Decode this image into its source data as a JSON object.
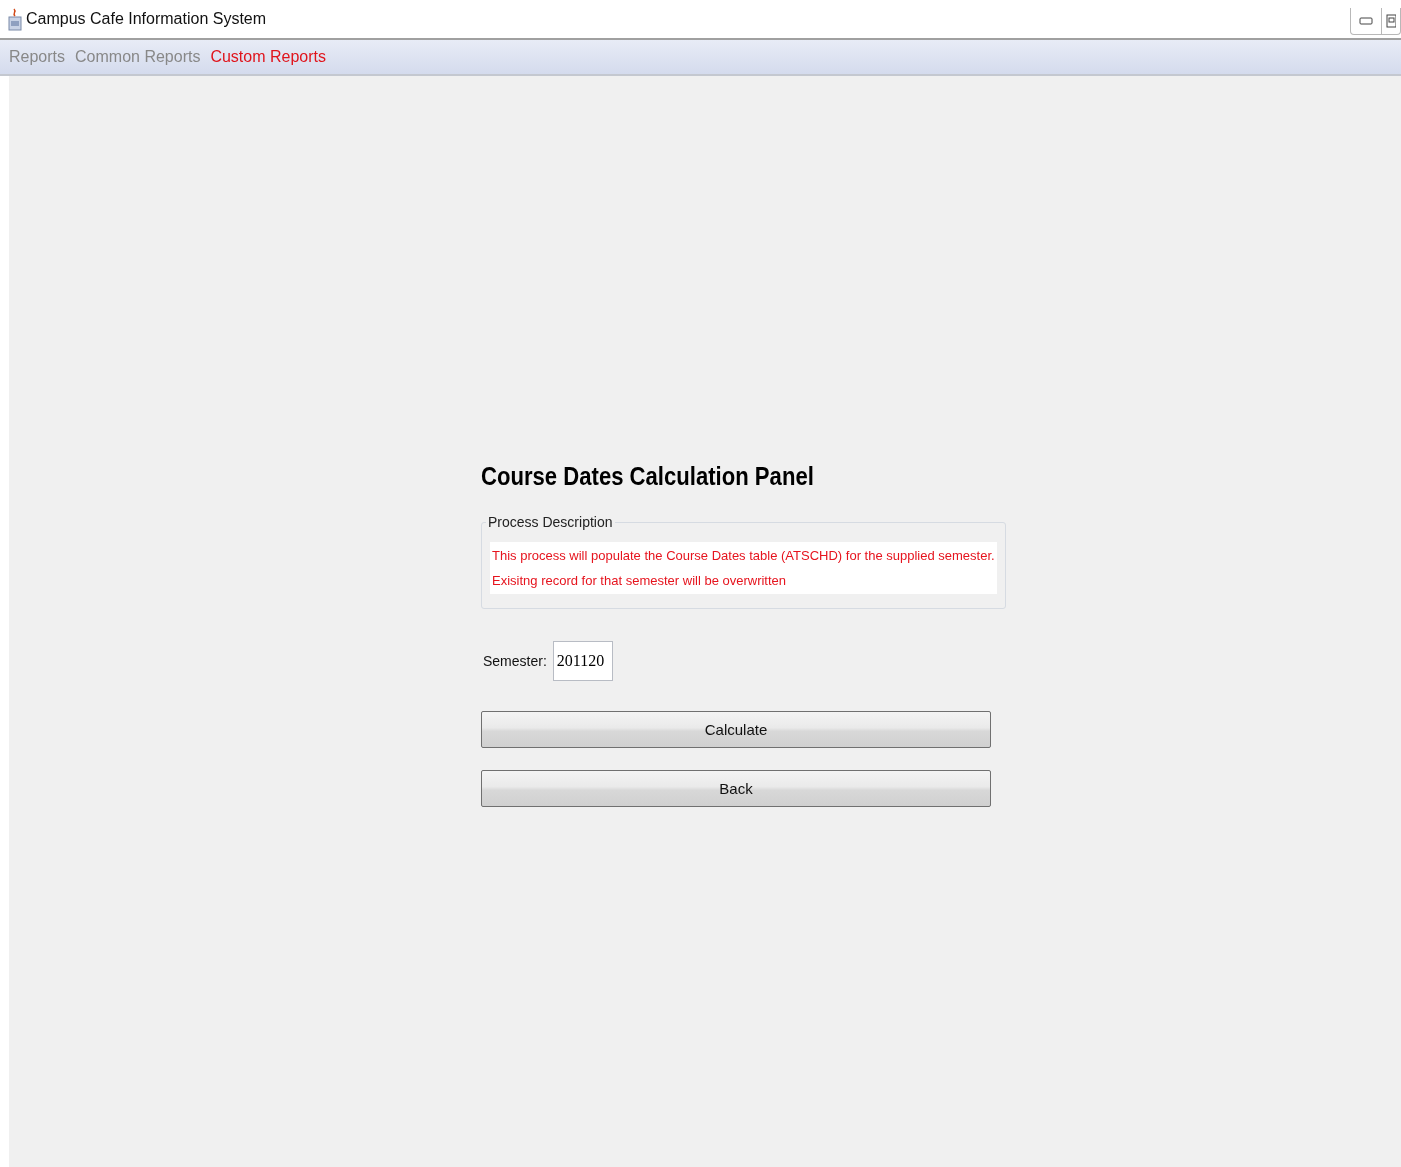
{
  "window": {
    "title": "Campus Cafe Information System"
  },
  "menu": [
    {
      "label": "Reports",
      "selected": false
    },
    {
      "label": "Common Reports",
      "selected": false
    },
    {
      "label": "Custom Reports",
      "selected": true
    }
  ],
  "panel": {
    "title": "Course Dates Calculation Panel",
    "description_group": "Process Description",
    "description_lines": [
      "This process will populate the Course Dates table (ATSCHD) for the supplied semester.",
      "Exisitng record for that semester will be overwritten"
    ],
    "semester": {
      "label": "Semester:",
      "value": "201120"
    },
    "buttons": [
      "Calculate",
      "Back"
    ]
  }
}
